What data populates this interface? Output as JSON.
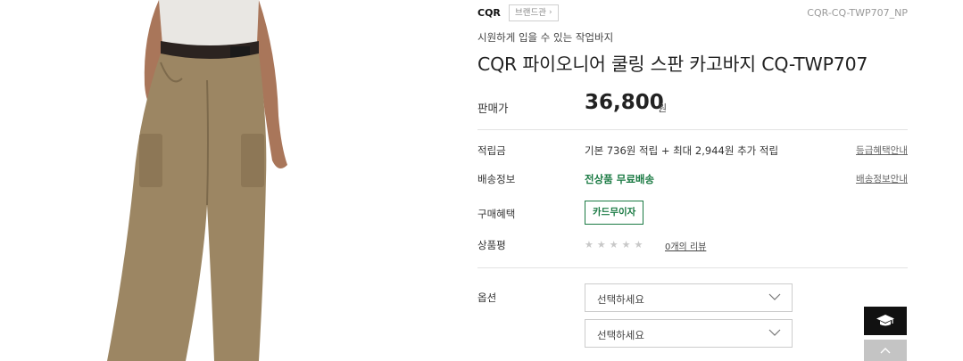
{
  "product": {
    "brand": "CQR",
    "brand_link_label": "브랜드관",
    "model_code": "CQR-CQ-TWP707_NP",
    "subtitle": "시원하게 입을 수 있는 작업바지",
    "title": "CQR 파이오니어 쿨링 스판 카고바지 CQ-TWP707",
    "image_icon": "cargo-pants-photo"
  },
  "price": {
    "label": "판매가",
    "value": "36,800",
    "unit": "원"
  },
  "details": {
    "points": {
      "label": "적립금",
      "value": "기본 736원 적립 + 최대 2,944원 추가 적립",
      "link": "등급혜택안내"
    },
    "shipping": {
      "label": "배송정보",
      "value": "전상품 무료배송",
      "link": "배송정보안내"
    },
    "benefit": {
      "label": "구매혜택",
      "badge": "카드무이자"
    },
    "review": {
      "label": "상품평",
      "rating": 0,
      "max_rating": 5,
      "link": "0개의 리뷰"
    }
  },
  "options": {
    "label": "옵션",
    "selects": [
      {
        "value": "선택하세요"
      },
      {
        "value": "선택하세요"
      }
    ]
  },
  "floating": {
    "primary_icon": "graduation-cap-icon",
    "secondary_icon": "chevron-up-icon"
  },
  "colors": {
    "accent_green": "#1a7a43",
    "float_dark": "#111111",
    "float_light": "#c4c4c4"
  }
}
